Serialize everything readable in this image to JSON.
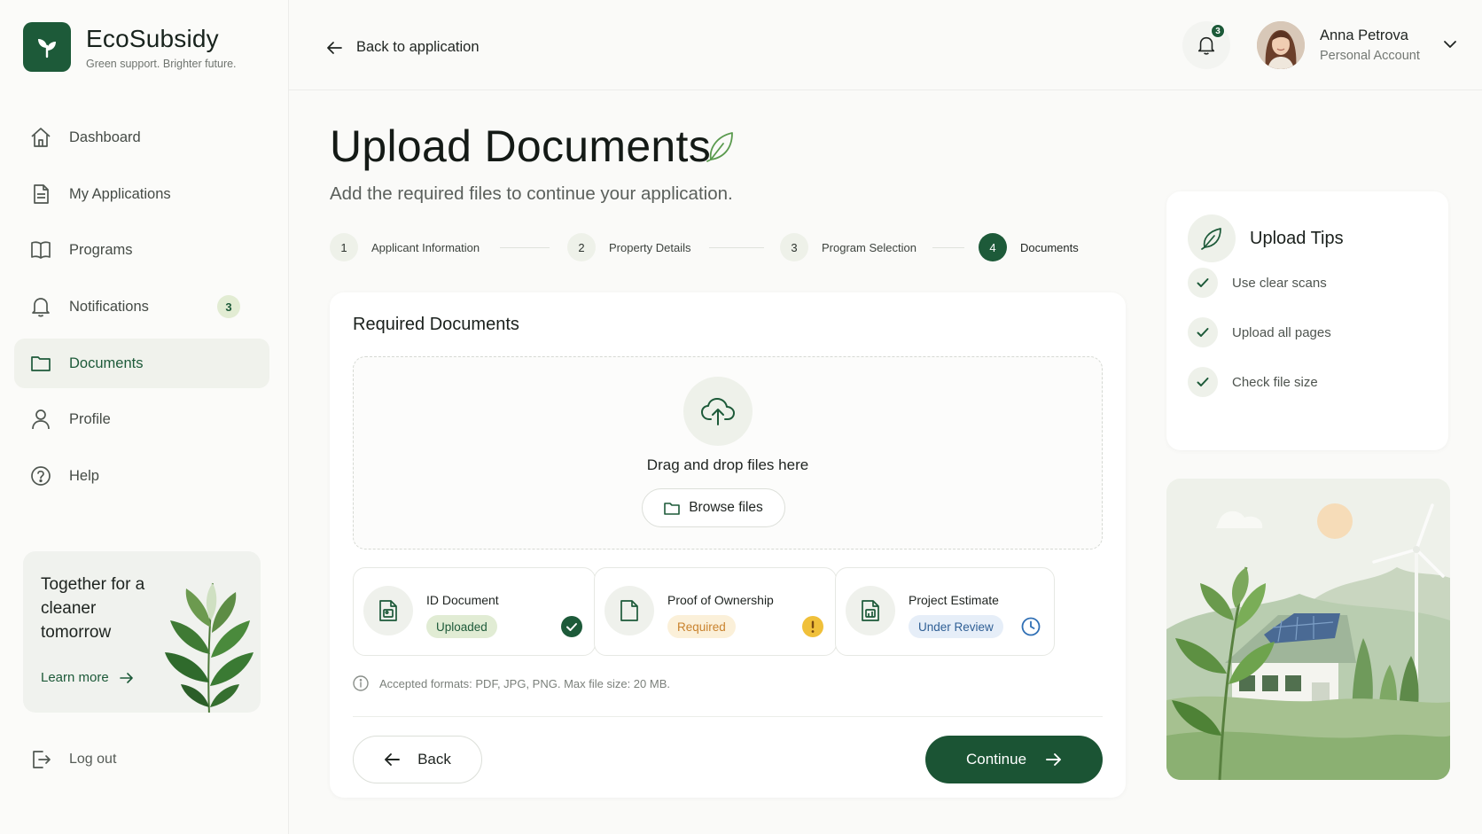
{
  "brand": {
    "name": "EcoSubsidy",
    "tagline": "Green support. Brighter future."
  },
  "sidebar": {
    "items": [
      {
        "label": "Dashboard",
        "icon": "home-icon"
      },
      {
        "label": "My Applications",
        "icon": "file-icon"
      },
      {
        "label": "Programs",
        "icon": "book-icon"
      },
      {
        "label": "Notifications",
        "icon": "bell-icon",
        "badge": "3"
      },
      {
        "label": "Documents",
        "icon": "folder-icon",
        "active": true
      },
      {
        "label": "Profile",
        "icon": "user-icon"
      },
      {
        "label": "Help",
        "icon": "help-icon"
      }
    ],
    "promo": {
      "title": "Together for a cleaner tomorrow",
      "link": "Learn more"
    },
    "logout": "Log out"
  },
  "topbar": {
    "back_label": "Back to application",
    "notification_count": "3",
    "user": {
      "name": "Anna Petrova",
      "account": "Personal Account"
    }
  },
  "page": {
    "title": "Upload Documents",
    "subtitle": "Add the required files to continue your application."
  },
  "stepper": {
    "steps": [
      {
        "num": "1",
        "label": "Applicant Information"
      },
      {
        "num": "2",
        "label": "Property Details"
      },
      {
        "num": "3",
        "label": "Program Selection"
      },
      {
        "num": "4",
        "label": "Documents",
        "active": true
      }
    ]
  },
  "required": {
    "title": "Required Documents",
    "drop_text": "Drag and drop files here",
    "browse_label": "Browse files",
    "documents": [
      {
        "name": "ID Document",
        "status": "Uploaded",
        "state": "uploaded"
      },
      {
        "name": "Proof of Ownership",
        "status": "Required",
        "state": "required"
      },
      {
        "name": "Project Estimate",
        "status": "Under Review",
        "state": "review"
      }
    ],
    "formats_note": "Accepted formats: PDF, JPG, PNG. Max file size: 20 MB.",
    "back_label": "Back",
    "continue_label": "Continue"
  },
  "tips": {
    "title": "Upload Tips",
    "items": [
      "Use clear scans",
      "Upload all pages",
      "Check file size"
    ]
  },
  "colors": {
    "primary": "#1d5a39",
    "required": "#e8b53a",
    "review": "#2f5f95",
    "background": "#fafaf8"
  }
}
